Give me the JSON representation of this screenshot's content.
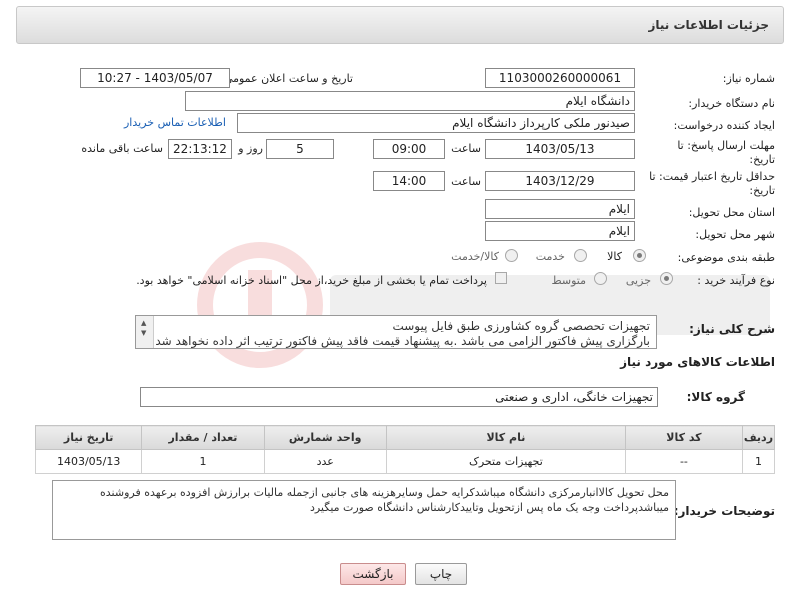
{
  "page": {
    "title": "جزئیات اطلاعات نیاز"
  },
  "fields": {
    "need_number": {
      "label": "شماره نیاز:",
      "value": "1103000260000061"
    },
    "announce_datetime": {
      "label": "تاریخ و ساعت اعلان عمومی:",
      "value": "1403/05/07 - 10:27"
    },
    "buyer_org": {
      "label": "نام دستگاه خریدار:",
      "value": "دانشگاه ایلام"
    },
    "requester": {
      "label": "ایجاد کننده درخواست:",
      "value": "صیدنور ملکی کارپرداز دانشگاه ایلام",
      "contact_link": "اطلاعات تماس خریدار"
    },
    "reply_deadline": {
      "label_line1": "مهلت ارسال پاسخ: تا",
      "label_line2": "تاریخ:",
      "date": "1403/05/13",
      "time_label": "ساعت",
      "time": "09:00",
      "days": "5",
      "days_label": "روز و",
      "remaining": "22:13:12",
      "remaining_label": "ساعت باقی مانده"
    },
    "price_validity": {
      "label_line1": "حداقل تاریخ اعتبار قیمت: تا",
      "label_line2": "تاریخ:",
      "date": "1403/12/29",
      "time_label": "ساعت",
      "time": "14:00"
    },
    "delivery_province": {
      "label": "استان محل تحویل:",
      "value": "ایلام"
    },
    "delivery_city": {
      "label": "شهر محل تحویل:",
      "value": "ایلام"
    },
    "category": {
      "label": "طبقه بندی موضوعی:",
      "options": [
        "کالا",
        "خدمت",
        "کالا/خدمت"
      ],
      "selected": "کالا"
    },
    "purchase_type": {
      "label": "نوع فرآیند خرید :",
      "options": [
        "جزیی",
        "متوسط"
      ],
      "selected": "جزیی",
      "treasury_note": "پرداخت تمام یا بخشی از مبلغ خرید،از محل \"اسناد خزانه اسلامی\" خواهد بود."
    }
  },
  "general_description": {
    "label": "شرح کلی نیاز:",
    "lines": [
      "تجهیزات تحصصی گروه کشاورزی  طبق فایل پیوست",
      "بارگزاری پیش فاکتور الزامی می باشد .به پیشنهاد قیمت فاقد پیش فاکتور ترتیب اثر داده نخواهد شد"
    ]
  },
  "goods_section": {
    "title": "اطلاعات کالاهای مورد نیاز",
    "group_label": "گروه کالا:",
    "group_value": "تجهیزات خانگی، اداری و صنعتی"
  },
  "table": {
    "headers": [
      "ردیف",
      "کد کالا",
      "نام کالا",
      "واحد شمارش",
      "تعداد / مقدار",
      "تاریخ نیاز"
    ],
    "rows": [
      [
        "1",
        "--",
        "تجهیزات متحرک",
        "عدد",
        "1",
        "1403/05/13"
      ]
    ]
  },
  "buyer_notes": {
    "label": "توضیحات خریدار:",
    "text": "محل تحویل کالاانبارمرکزی دانشگاه میباشدکرایه حمل وسایرهزینه های جانبی ازجمله مالیات برارزش افزوده برعهده فروشنده میباشدپرداخت وجه یک ماه پس ازتحویل وتاییدکارشناس دانشگاه صورت میگیرد"
  },
  "buttons": {
    "print": "چاپ",
    "back": "بازگشت"
  },
  "colors": {
    "link": "#1a5fb4",
    "header_bg": "#e6e6e6",
    "back_button": "#f4c9c9"
  }
}
